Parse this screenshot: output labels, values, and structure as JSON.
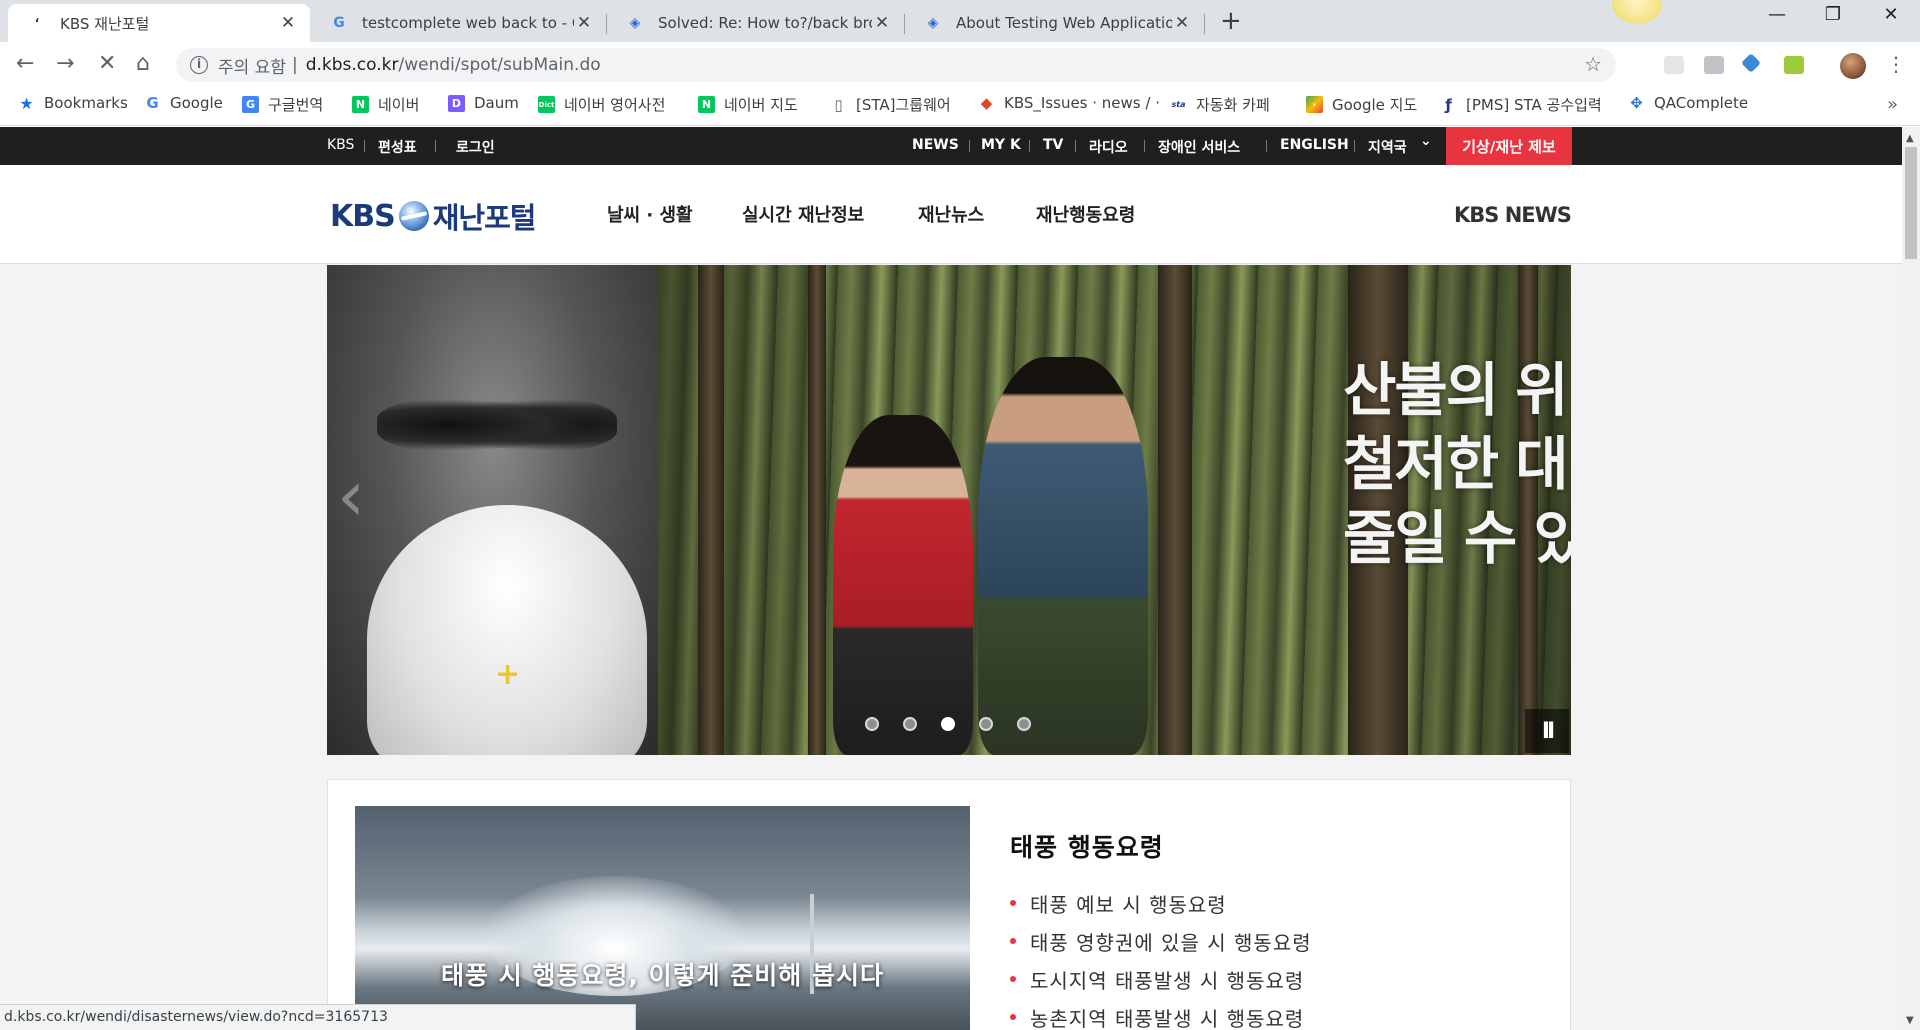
{
  "browser": {
    "tabs": [
      {
        "title": "KBS 재난포털",
        "active": true
      },
      {
        "title": "testcomplete web back to - Go"
      },
      {
        "title": "Solved: Re: How to?/back brow"
      },
      {
        "title": "About Testing Web Application"
      }
    ],
    "new_tab": "+",
    "window_controls": {
      "minimize": "—",
      "restore": "❐",
      "close": "✕"
    },
    "address": {
      "warning": "주의 요함",
      "separator": "|",
      "host": "d.kbs.co.kr",
      "path": "/wendi/spot/subMain.do"
    },
    "bookmarks": [
      {
        "label": "Bookmarks",
        "icon": "star-icon",
        "color": "#1a73e8"
      },
      {
        "label": "Google",
        "icon": "google-icon",
        "color": "#4285f4"
      },
      {
        "label": "구글번역",
        "icon": "google-translate-icon",
        "color": "#4285f4"
      },
      {
        "label": "네이버",
        "icon": "naver-icon",
        "color": "#03c75a"
      },
      {
        "label": "Daum",
        "icon": "daum-icon",
        "color": "#7c5cff"
      },
      {
        "label": "네이버 영어사전",
        "icon": "naver-dict-icon",
        "color": "#03c75a"
      },
      {
        "label": "네이버 지도",
        "icon": "naver-map-icon",
        "color": "#03c75a"
      },
      {
        "label": "[STA]그룹웨어",
        "icon": "document-icon",
        "color": "#5f6368"
      },
      {
        "label": "KBS_Issues · news / ·",
        "icon": "gitlab-icon",
        "color": "#e24329"
      },
      {
        "label": "자동화 카페",
        "icon": "sta-icon",
        "color": "#1a3a8a"
      },
      {
        "label": "Google 지도",
        "icon": "google-maps-icon",
        "color": "#34a853"
      },
      {
        "label": "[PMS] STA 공수입력",
        "icon": "pms-icon",
        "color": "#1a3a8a"
      },
      {
        "label": "QAComplete",
        "icon": "qacomplete-icon",
        "color": "#2a6fd6"
      }
    ],
    "bookmarks_more": "»",
    "status_url": "d.kbs.co.kr/wendi/disasternews/view.do?ncd=3165713"
  },
  "site": {
    "topbar": {
      "left": [
        "KBS",
        "편성표",
        "로그인"
      ],
      "right": [
        "NEWS",
        "MY K",
        "TV",
        "라디오",
        "장애인 서비스",
        "ENGLISH",
        "지역국"
      ],
      "region_arrow": "⌄",
      "report": "기상/재난 제보"
    },
    "logo": {
      "brand": "KBS",
      "name": "재난포털"
    },
    "gnb": [
      "날씨 · 생활",
      "실시간 재난정보",
      "재난뉴스",
      "재난행동요령"
    ],
    "kbs_news": "KBS NEWS",
    "hero": {
      "lines": [
        "산불의 위",
        "철저한 대",
        "줄일 수 있"
      ],
      "slide_count": 5,
      "active_slide": 3,
      "pause": "II"
    },
    "guide": {
      "video_caption": "태풍 시 행동요령, 이렇게 준비해 봅시다",
      "title": "태풍 행동요령",
      "items": [
        "태풍 예보 시 행동요령",
        "태풍 영향권에 있을 시 행동요령",
        "도시지역 태풍발생 시 행동요령",
        "농촌지역 태풍발생 시 행동요령"
      ]
    },
    "colors": {
      "accent": "#e8343f",
      "brand": "#1b3a7a",
      "topbar": "#1f1f1f"
    }
  }
}
